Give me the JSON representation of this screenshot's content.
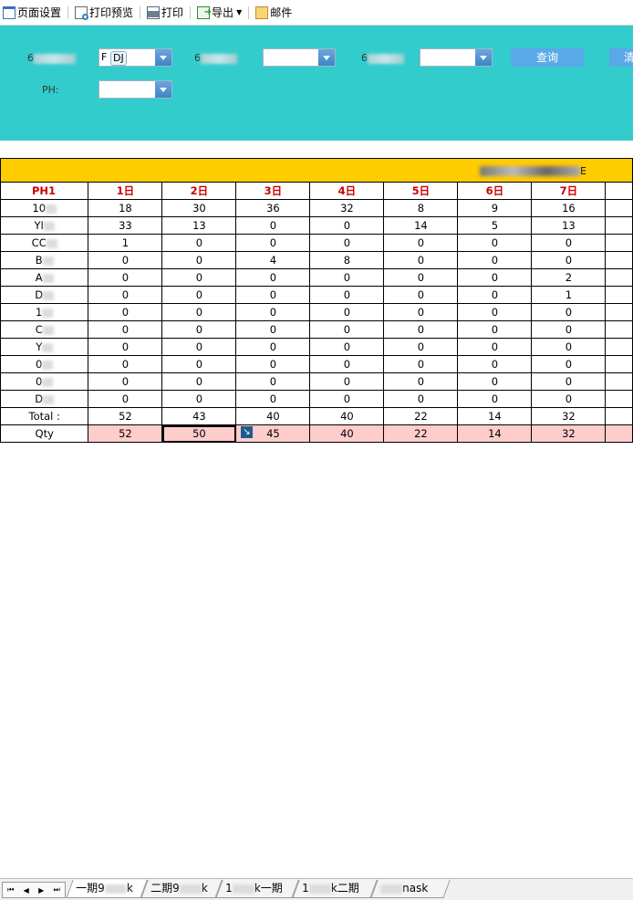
{
  "toolbar": {
    "items": [
      {
        "label": "页面设置",
        "icon": "page-setup-icon"
      },
      {
        "label": "打印预览",
        "icon": "print-preview-icon"
      },
      {
        "label": "打印",
        "icon": "printer-icon"
      },
      {
        "label": "导出",
        "icon": "export-icon"
      },
      {
        "label": "邮件",
        "icon": "mail-icon"
      }
    ]
  },
  "filter": {
    "label1_prefix": "6",
    "label2_prefix": "6",
    "label3_prefix": "6",
    "chip_prefix": "F",
    "chip_value": "DJ",
    "ph_label": "PH:",
    "query_button": "查询",
    "second_button": "清"
  },
  "report": {
    "title_suffix": "E",
    "header": [
      "PH1",
      "1日",
      "2日",
      "3日",
      "4日",
      "5日",
      "6日",
      "7日",
      ""
    ],
    "rows": [
      {
        "name": "10",
        "values": [
          "18",
          "30",
          "36",
          "32",
          "8",
          "9",
          "16"
        ]
      },
      {
        "name": "YI",
        "values": [
          "33",
          "13",
          "0",
          "0",
          "14",
          "5",
          "13"
        ]
      },
      {
        "name": "CC",
        "values": [
          "1",
          "0",
          "0",
          "0",
          "0",
          "0",
          "0"
        ]
      },
      {
        "name": "B",
        "values": [
          "0",
          "0",
          "4",
          "8",
          "0",
          "0",
          "0"
        ]
      },
      {
        "name": "A",
        "values": [
          "0",
          "0",
          "0",
          "0",
          "0",
          "0",
          "2"
        ]
      },
      {
        "name": "D",
        "values": [
          "0",
          "0",
          "0",
          "0",
          "0",
          "0",
          "1"
        ]
      },
      {
        "name": "1",
        "values": [
          "0",
          "0",
          "0",
          "0",
          "0",
          "0",
          "0"
        ]
      },
      {
        "name": "C",
        "values": [
          "0",
          "0",
          "0",
          "0",
          "0",
          "0",
          "0"
        ]
      },
      {
        "name": "Y",
        "values": [
          "0",
          "0",
          "0",
          "0",
          "0",
          "0",
          "0"
        ]
      },
      {
        "name": "0",
        "values": [
          "0",
          "0",
          "0",
          "0",
          "0",
          "0",
          "0"
        ]
      },
      {
        "name": "0",
        "values": [
          "0",
          "0",
          "0",
          "0",
          "0",
          "0",
          "0"
        ]
      },
      {
        "name": "D",
        "values": [
          "0",
          "0",
          "0",
          "0",
          "0",
          "0",
          "0"
        ]
      }
    ],
    "total": {
      "label": "Total :",
      "values": [
        "52",
        "43",
        "40",
        "40",
        "22",
        "14",
        "32"
      ]
    },
    "qty": {
      "label": "Qty",
      "values": [
        "52",
        "50",
        "45",
        "40",
        "22",
        "14",
        "32"
      ]
    }
  },
  "sheets": {
    "nav": [
      "⏮",
      "◀",
      "▶",
      "⏭"
    ],
    "tabs": [
      {
        "pre": "一期9",
        "post": "k"
      },
      {
        "pre": "二期9",
        "post": "k"
      },
      {
        "pre": "1",
        "post": "k一期"
      },
      {
        "pre": "1",
        "post": "k二期"
      },
      {
        "pre": "",
        "post": "nask"
      }
    ]
  },
  "colors": {
    "filter_bg": "#33cccc",
    "title_bg": "#ffcc00",
    "header_text": "#cc0000",
    "qty_bg": "#ffcccc",
    "button_bg": "#5aa8e8"
  }
}
